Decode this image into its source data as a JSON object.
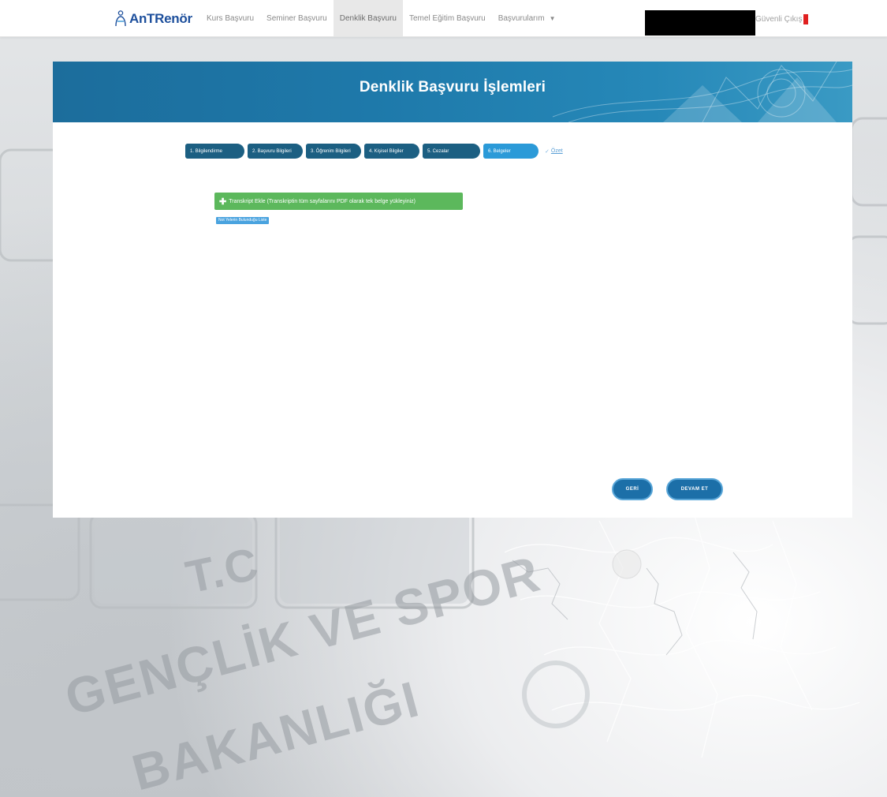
{
  "brand": {
    "name_main": "AnTRenör",
    "prefix": "",
    "accent": ""
  },
  "nav": {
    "items": [
      {
        "label": "Kurs Başvuru",
        "active": false
      },
      {
        "label": "Seminer Başvuru",
        "active": false
      },
      {
        "label": "Denklik Başvuru",
        "active": true
      },
      {
        "label": "Temel Eğitim Başvuru",
        "active": false
      },
      {
        "label": "Başvurularım",
        "active": false,
        "dropdown": true
      }
    ],
    "logout_label": "Güvenli Çıkış"
  },
  "background": {
    "line1": "T.C",
    "line2": "GENÇLİK VE SPOR",
    "line3": "BAKANLIĞI"
  },
  "page": {
    "title": "Denklik Başvuru İşlemleri"
  },
  "steps": [
    {
      "label": "1. Bilgilendirme",
      "active": false
    },
    {
      "label": "2. Başvuru Bilgileri",
      "active": false
    },
    {
      "label": "3. Öğrenim Bilgileri",
      "active": false
    },
    {
      "label": "4. Kişisel Bilgiler",
      "active": false
    },
    {
      "label": "5. Cezalar",
      "active": false
    },
    {
      "label": "6. Belgeler",
      "active": true
    }
  ],
  "reset_label": "Özet",
  "upload": {
    "label": "Transkript Ekle (Transkriptin tüm sayfalarını PDF olarak tek belge yükleyiniz)",
    "file_label": "Not Yelerin Bulunduğu Liste"
  },
  "buttons": {
    "back": "GERİ",
    "next": "DEVAM ET"
  },
  "colors": {
    "banner": "#1e79aa",
    "step": "#1c5f82",
    "step_active": "#2b9ad8",
    "upload": "#5cb85c",
    "pill": "#1c6fa8"
  }
}
